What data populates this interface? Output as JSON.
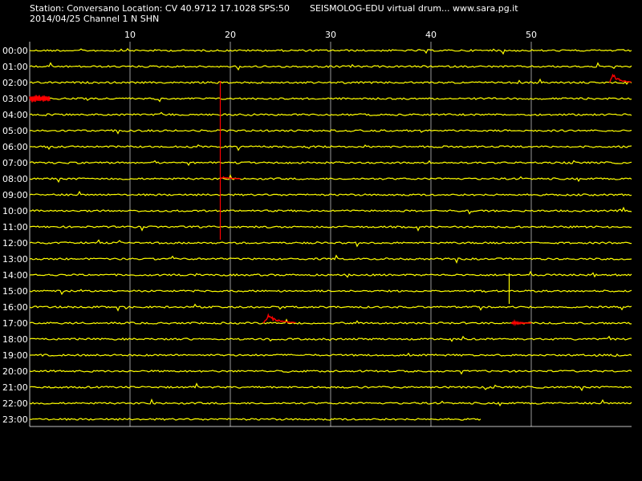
{
  "header": {
    "station_line": "Station: Conversano Location: CV 40.9712 17.1028 SPS:50",
    "title": "SEISMOLOG-EDU virtual drum... www.sara.pg.it",
    "date_line": "2014/04/25  Channel 1 N SHN"
  },
  "colors": {
    "background": "#000000",
    "trace": "#ffff00",
    "event": "#ff0000",
    "grid": "#ffffff",
    "text": "#ffffff"
  },
  "chart_data": {
    "type": "line",
    "title": "SEISMOLOG-EDU virtual drum... www.sara.pg.it",
    "xlabel": "",
    "ylabel": "",
    "x_unit": "minute",
    "xlim": [
      0,
      60
    ],
    "x_ticks": [
      10,
      20,
      30,
      40,
      50
    ],
    "y_tick_labels": [
      "00:00",
      "01:00",
      "02:00",
      "03:00",
      "04:00",
      "05:00",
      "06:00",
      "07:00",
      "08:00",
      "09:00",
      "10:00",
      "11:00",
      "12:00",
      "13:00",
      "14:00",
      "15:00",
      "16:00",
      "17:00",
      "18:00",
      "19:00",
      "20:00",
      "21:00",
      "22:00",
      "23:00"
    ],
    "grid": true,
    "last_row_end_minute": 45,
    "events": [
      {
        "hour": "02:00",
        "start_minute": 57.8,
        "end_minute": 60.0,
        "amplitude": "high"
      },
      {
        "hour": "03:00",
        "start_minute": 0.0,
        "end_minute": 2.0,
        "amplitude": "medium"
      },
      {
        "hour": "08:00",
        "start_minute": 19.0,
        "end_minute": 21.0,
        "amplitude": "low"
      },
      {
        "hour": "17:00",
        "start_minute": 23.3,
        "end_minute": 26.5,
        "amplitude": "high"
      },
      {
        "hour": "17:00",
        "start_minute": 48.0,
        "end_minute": 50.0,
        "amplitude": "low"
      }
    ],
    "vertical_marks": [
      {
        "minute": 19.0,
        "from_hour": "02:00",
        "to_hour": "11:00",
        "color": "event"
      },
      {
        "minute": 47.8,
        "from_hour": "14:00",
        "to_hour": "15:00",
        "color": "trace"
      }
    ]
  }
}
